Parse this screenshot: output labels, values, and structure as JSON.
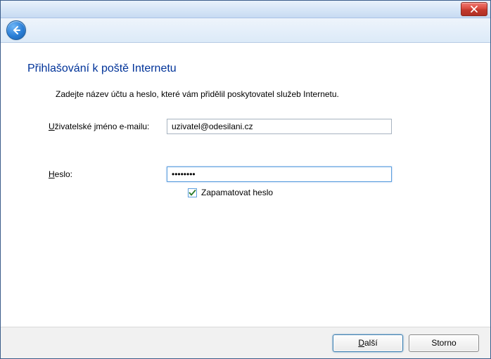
{
  "page": {
    "title": "Přihlašování k poště Internetu",
    "instruction": "Zadejte název účtu a heslo, které vám přidělil poskytovatel služeb Internetu."
  },
  "fields": {
    "username_label_prefix": "U",
    "username_label_rest": "živatelské jméno e-mailu:",
    "username_value": "uzivatel@odesilani.cz",
    "password_label_prefix": "H",
    "password_label_rest": "eslo:",
    "password_value": "••••••••",
    "remember_prefix": "Z",
    "remember_rest": "apamatovat heslo",
    "remember_checked": true
  },
  "buttons": {
    "next_prefix": "D",
    "next_rest": "alší",
    "cancel": "Storno"
  }
}
